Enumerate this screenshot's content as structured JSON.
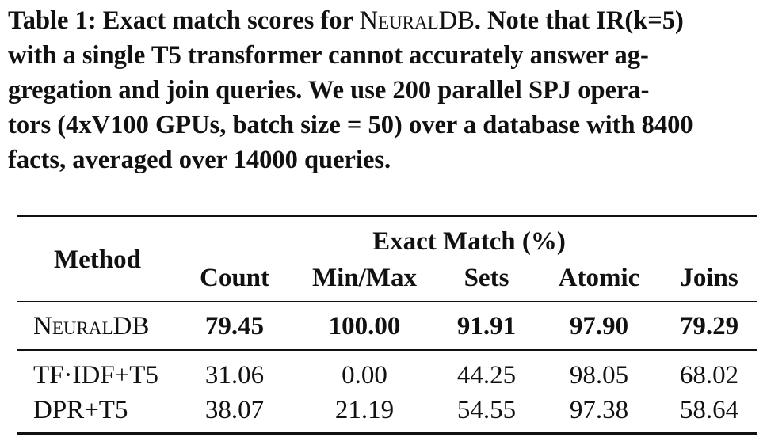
{
  "caption": {
    "line1_prefix": "Table 1: Exact match scores for ",
    "line1_sc": "NeuralDB",
    "line1_suffix": ". Note that IR(k=5)",
    "line2": "with a single T5 transformer cannot accurately answer ag-",
    "line3": "gregation and join queries. We use 200 parallel SPJ opera-",
    "line4": "tors (4xV100 GPUs, batch size = 50) over a database with 8400",
    "line5": "facts, averaged over 14000 queries."
  },
  "table": {
    "method_header": "Method",
    "group_header": "Exact Match (%)",
    "columns": [
      "Count",
      "Min/Max",
      "Sets",
      "Atomic",
      "Joins"
    ],
    "rows": [
      {
        "method": "NeuralDB",
        "values": [
          "79.45",
          "100.00",
          "91.91",
          "97.90",
          "79.29"
        ],
        "bold": true
      },
      {
        "method": "TF·IDF+T5",
        "values": [
          "31.06",
          "0.00",
          "44.25",
          "98.05",
          "68.02"
        ],
        "bold": false
      },
      {
        "method": "DPR+T5",
        "values": [
          "38.07",
          "21.19",
          "54.55",
          "97.38",
          "58.64"
        ],
        "bold": false
      }
    ]
  }
}
